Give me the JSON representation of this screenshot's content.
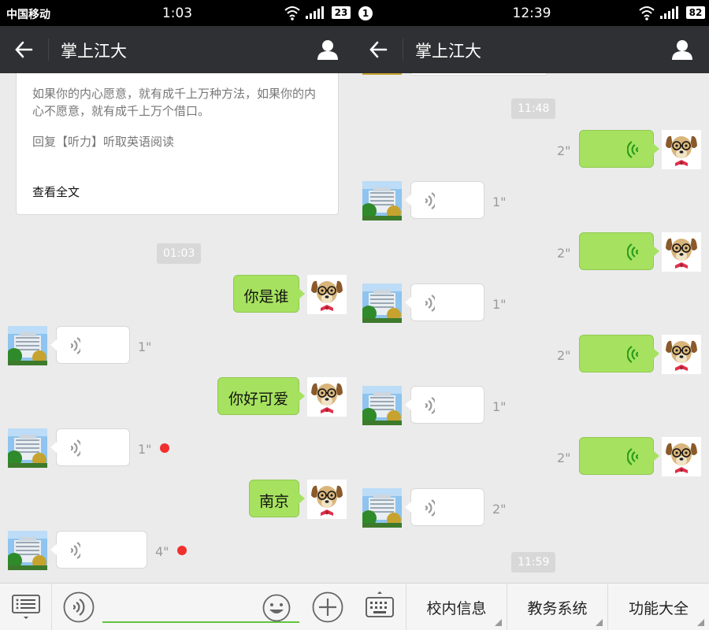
{
  "left": {
    "status": {
      "carrier": "中国移动",
      "time": "1:03",
      "battery": "23"
    },
    "header": {
      "title": "掌上江大"
    },
    "article": {
      "quote": "如果你的内心愿意，就有成千上万种方法，如果你的内心不愿意，就有成千上万个借口。",
      "reply": "回复【听力】听取英语阅读",
      "read_more": "查看全文"
    },
    "timestamp": "01:03",
    "messages": [
      {
        "side": "me",
        "type": "text",
        "text": "你是谁"
      },
      {
        "side": "them",
        "type": "voice",
        "duration": "1\""
      },
      {
        "side": "me",
        "type": "text",
        "text": "你好可爱"
      },
      {
        "side": "them",
        "type": "voice",
        "duration": "1\"",
        "unread": true
      },
      {
        "side": "me",
        "type": "text",
        "text": "南京"
      },
      {
        "side": "them",
        "type": "voice",
        "duration": "4\"",
        "unread": true
      }
    ]
  },
  "right": {
    "status": {
      "notification": "1",
      "time": "12:39",
      "battery": "82"
    },
    "header": {
      "title": "掌上江大"
    },
    "timestamps": [
      "11:48",
      "11:59"
    ],
    "messages": [
      {
        "side": "me",
        "type": "voice",
        "duration": "2\""
      },
      {
        "side": "them",
        "type": "voice",
        "duration": "1\""
      },
      {
        "side": "me",
        "type": "voice",
        "duration": "2\""
      },
      {
        "side": "them",
        "type": "voice",
        "duration": "1\""
      },
      {
        "side": "me",
        "type": "voice",
        "duration": "2\""
      },
      {
        "side": "them",
        "type": "voice",
        "duration": "1\""
      },
      {
        "side": "me",
        "type": "voice",
        "duration": "2\""
      },
      {
        "side": "them",
        "type": "voice",
        "duration": "2\""
      }
    ],
    "menu": [
      "校内信息",
      "教务系统",
      "功能大全"
    ]
  },
  "colors": {
    "header_bg": "#2f3033",
    "bubble_green": "#a6e25f",
    "chat_bg": "#ebebeb",
    "unread_dot": "#f0302f"
  },
  "icons": [
    "back-arrow-icon",
    "person-icon",
    "wifi-icon",
    "signal-icon",
    "voice-wave-icon",
    "list-menu-icon",
    "voice-input-icon",
    "emoji-icon",
    "plus-icon",
    "keyboard-icon"
  ]
}
